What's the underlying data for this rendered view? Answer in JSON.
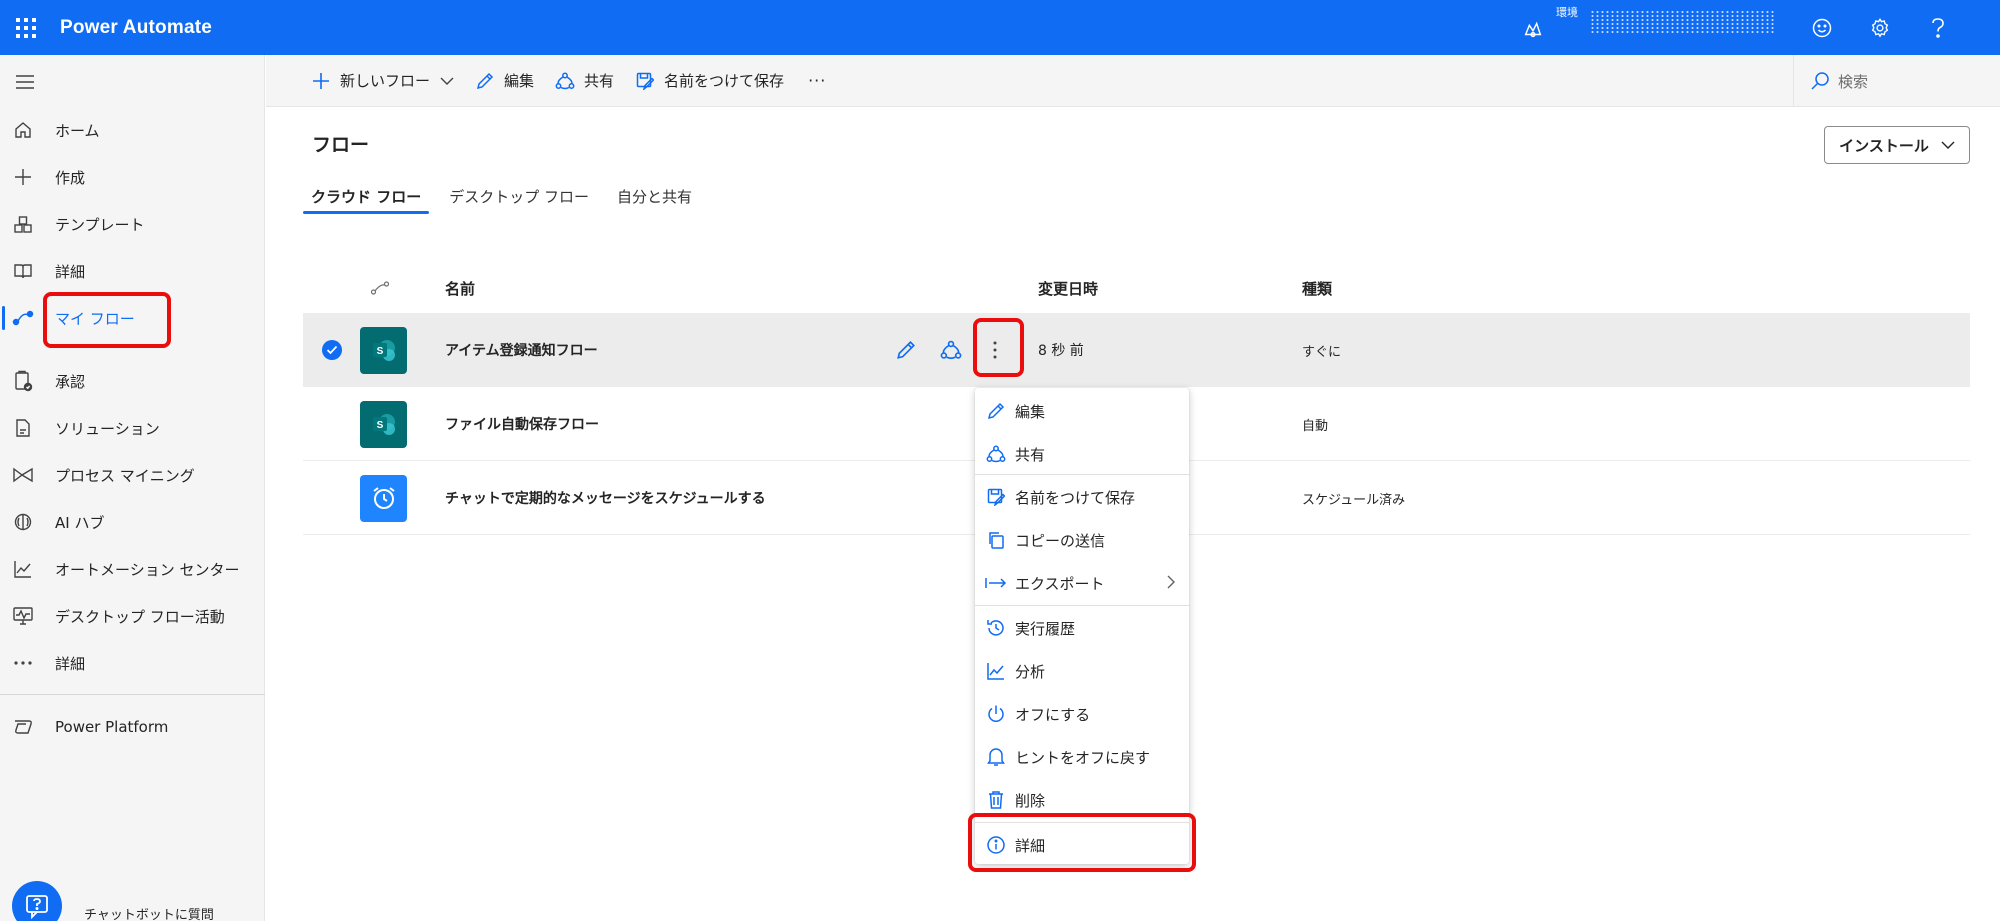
{
  "app": {
    "title": "Power Automate"
  },
  "environment": {
    "label": "環境"
  },
  "colors": {
    "brand": "#0f6cf3",
    "highlight": "#ea0d0d",
    "sharepoint_tile": "#036c70",
    "schedule_tile": "#1f85ff"
  },
  "sidebar": {
    "items": [
      {
        "label": "ホーム",
        "icon": "home-icon"
      },
      {
        "label": "作成",
        "icon": "plus-icon"
      },
      {
        "label": "テンプレート",
        "icon": "template-icon"
      },
      {
        "label": "詳細",
        "icon": "book-icon"
      },
      {
        "label": "マイ フロー",
        "icon": "flow-icon",
        "active": true
      },
      {
        "label": "承認",
        "icon": "approval-icon"
      },
      {
        "label": "ソリューション",
        "icon": "solution-icon"
      },
      {
        "label": "プロセス マイニング",
        "icon": "process-mining-icon"
      },
      {
        "label": "AI ハブ",
        "icon": "ai-hub-icon"
      },
      {
        "label": "オートメーション センター",
        "icon": "chart-icon"
      },
      {
        "label": "デスクトップ フロー活動",
        "icon": "monitor-icon"
      },
      {
        "label": "詳細",
        "icon": "more-icon"
      }
    ],
    "platform": {
      "label": "Power Platform",
      "icon": "power-platform-icon"
    },
    "chatbot": {
      "label": "チャットボットに質問"
    }
  },
  "commandbar": {
    "new_flow": "新しいフロー",
    "edit": "編集",
    "share": "共有",
    "save_as": "名前をつけて保存",
    "more": "···",
    "search_placeholder": "検索"
  },
  "page": {
    "title": "フロー",
    "install": "インストール",
    "tabs": [
      {
        "label": "クラウド フロー",
        "active": true
      },
      {
        "label": "デスクトップ フロー"
      },
      {
        "label": "自分と共有"
      }
    ]
  },
  "table": {
    "headers": {
      "name": "名前",
      "modified": "変更日時",
      "type": "種類"
    },
    "rows": [
      {
        "name": "アイテム登録通知フロー",
        "modified": "8 秒 前",
        "type": "すぐに",
        "tile": "sharepoint",
        "selected": true
      },
      {
        "name": "ファイル自動保存フロー",
        "modified": "",
        "type": "自動",
        "tile": "sharepoint"
      },
      {
        "name": "チャットで定期的なメッセージをスケジュールする",
        "modified": "",
        "type": "スケジュール済み",
        "tile": "schedule"
      }
    ]
  },
  "context_menu": {
    "items": [
      {
        "label": "編集",
        "icon": "pencil-icon"
      },
      {
        "label": "共有",
        "icon": "share-icon"
      },
      {
        "label": "名前をつけて保存",
        "icon": "save-as-icon"
      },
      {
        "label": "コピーの送信",
        "icon": "copy-icon"
      },
      {
        "label": "エクスポート",
        "icon": "export-icon",
        "submenu": true
      },
      {
        "label": "実行履歴",
        "icon": "history-icon"
      },
      {
        "label": "分析",
        "icon": "analytics-icon"
      },
      {
        "label": "オフにする",
        "icon": "power-icon"
      },
      {
        "label": "ヒントをオフに戻す",
        "icon": "bell-icon"
      },
      {
        "label": "削除",
        "icon": "trash-icon"
      },
      {
        "label": "詳細",
        "icon": "info-icon"
      }
    ]
  }
}
